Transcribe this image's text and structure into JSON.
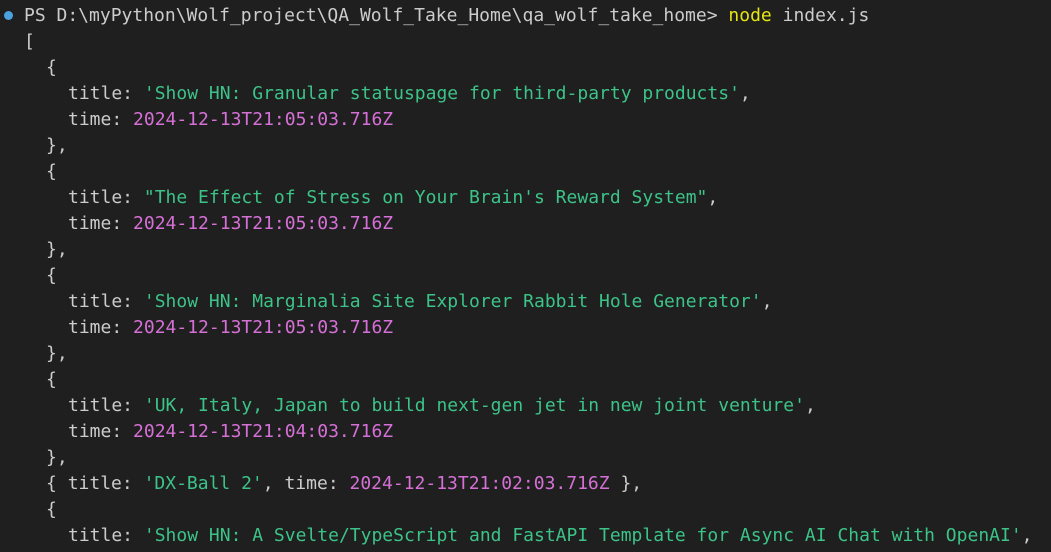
{
  "prompt": {
    "ps": "PS D:\\myPython\\Wolf_project\\QA_Wolf_Take_Home\\qa_wolf_take_home>",
    "command": "node",
    "argument": "index.js"
  },
  "colors": {
    "background": "#1f1f1f",
    "text": "#cccccc",
    "string": "#3cc388",
    "date": "#d670d6",
    "command": "#e5e510",
    "dot": "#4aa3df"
  },
  "syntax": {
    "open_bracket": "[",
    "open_brace": "{",
    "close_brace_comma": "},",
    "title_key": "title:",
    "time_key": "time:",
    "comma": ",",
    "inline_close": "},"
  },
  "entries": [
    {
      "title": "'Show HN: Granular statuspage for third-party products'",
      "time": "2024-12-13T21:05:03.716Z"
    },
    {
      "title": "\"The Effect of Stress on Your Brain's Reward System\"",
      "time": "2024-12-13T21:05:03.716Z"
    },
    {
      "title": "'Show HN: Marginalia Site Explorer Rabbit Hole Generator'",
      "time": "2024-12-13T21:05:03.716Z"
    },
    {
      "title": "'UK, Italy, Japan to build next-gen jet in new joint venture'",
      "time": "2024-12-13T21:04:03.716Z"
    },
    {
      "title": "'DX-Ball 2'",
      "time": "2024-12-13T21:02:03.716Z"
    },
    {
      "title": "'Show HN: A Svelte/TypeScript and FastAPI Template for Async AI Chat with OpenAI'"
    }
  ]
}
